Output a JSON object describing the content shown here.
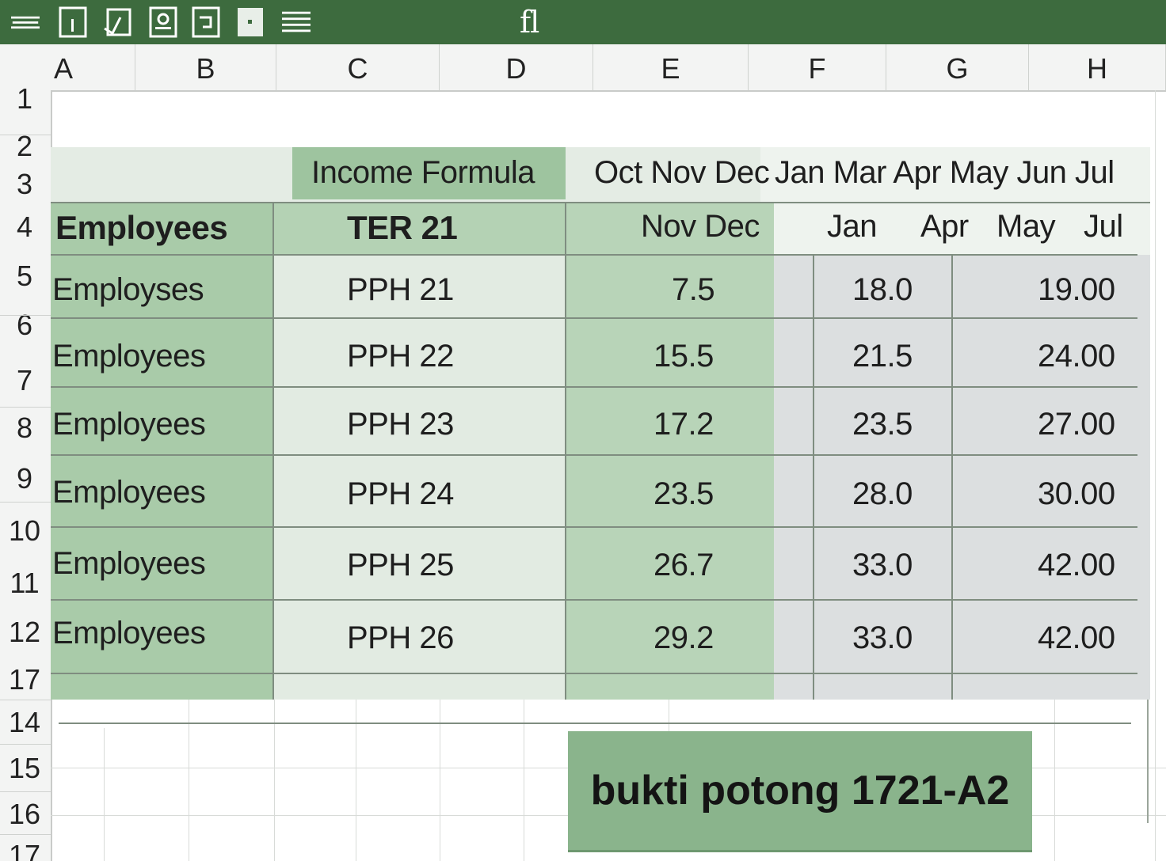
{
  "toolbar": {
    "function_label": "fl",
    "buttons": [
      "menu-icon",
      "cursor-icon",
      "check-icon",
      "image-icon",
      "bracket-icon",
      "fill-icon",
      "list-icon"
    ]
  },
  "columns": [
    "A",
    "B",
    "C",
    "D",
    "E",
    "F",
    "G",
    "H"
  ],
  "rows": [
    "1",
    "2",
    "3",
    "4",
    "5",
    "6",
    "7",
    "8",
    "9",
    "10",
    "11",
    "12",
    "17",
    "14",
    "15",
    "16",
    "17"
  ],
  "header_row_3": {
    "income_formula": "Income Formula",
    "months": "Oct Nov Dec",
    "months_right": "Jan Mar Apr May Jun Jul"
  },
  "header_row_4": {
    "employees": "Employees",
    "ter": "TER 21",
    "nov_dec": "Nov Dec",
    "jan": "Jan",
    "apr": "Apr",
    "may": "May",
    "jul": "Jul"
  },
  "table": [
    {
      "employee": "Employses",
      "tax": "PPH 21",
      "v1": "7.5",
      "v2": "18.0",
      "v3": "19.00"
    },
    {
      "employee": "Employees",
      "tax": "PPH 22",
      "v1": "15.5",
      "v2": "21.5",
      "v3": "24.00"
    },
    {
      "employee": "Employees",
      "tax": "PPH 23",
      "v1": "17.2",
      "v2": "23.5",
      "v3": "27.00"
    },
    {
      "employee": "Employees",
      "tax": "PPH 24",
      "v1": "23.5",
      "v2": "28.0",
      "v3": "30.00"
    },
    {
      "employee": "Employees",
      "tax": "PPH 25",
      "v1": "26.7",
      "v2": "33.0",
      "v3": "42.00"
    },
    {
      "employee": "Employees",
      "tax": "PPH 26",
      "v1": "29.2",
      "v2": "33.0",
      "v3": "42.00"
    }
  ],
  "footer_button": "bukti potong 1721-A2",
  "colors": {
    "toolbar": "#3d6b3e",
    "green_dark": "#a9cba9",
    "green_light": "#dfeadf",
    "gray": "#dcdfe0",
    "button": "#8ab48c"
  }
}
